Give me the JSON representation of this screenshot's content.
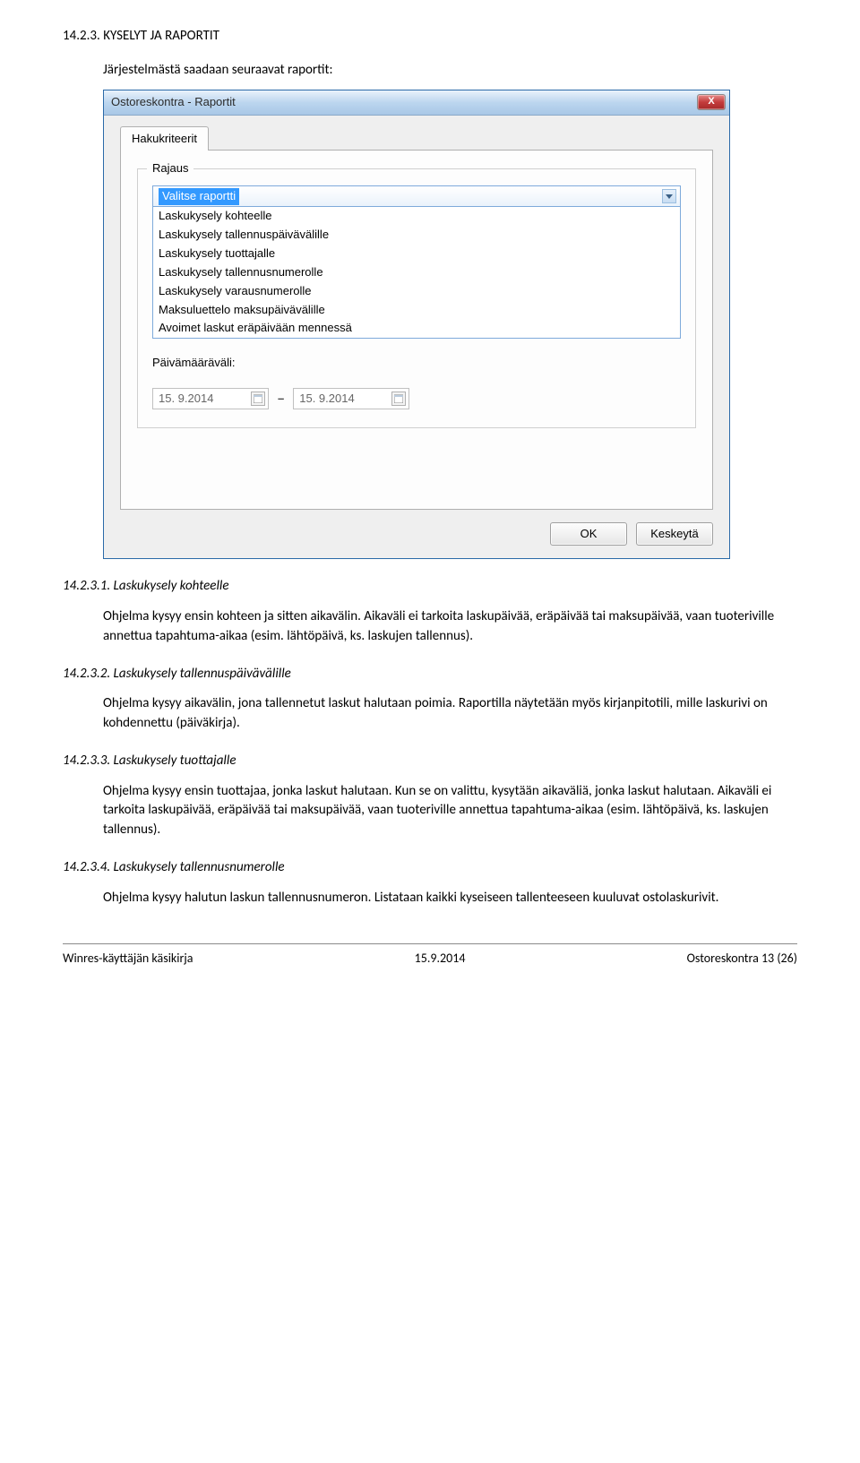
{
  "section": {
    "number": "14.2.3.",
    "title": "KYSELYT JA RAPORTIT",
    "intro": "Järjestelmästä saadaan seuraavat raportit:"
  },
  "dialog": {
    "title": "Ostoreskontra - Raportit",
    "close_label": "X",
    "tab_label": "Hakukriteerit",
    "legend": "Rajaus",
    "selected": "Valitse raportti",
    "options": [
      "Laskukysely kohteelle",
      "Laskukysely tallennuspäivävälille",
      "Laskukysely tuottajalle",
      "Laskukysely tallennusnumerolle",
      "Laskukysely varausnumerolle",
      "Maksuluettelo maksupäivävälille",
      "Avoimet laskut eräpäivään mennessä"
    ],
    "date_label": "Päivämääräväli:",
    "date_from": "15. 9.2014",
    "date_to": "15. 9.2014",
    "date_sep": "–",
    "ok_label": "OK",
    "cancel_label": "Keskeytä"
  },
  "subsections": {
    "s1": {
      "heading": "14.2.3.1. Laskukysely kohteelle",
      "body": "Ohjelma kysyy ensin kohteen ja sitten aikavälin. Aikaväli ei tarkoita laskupäivää, eräpäivää tai maksupäivää, vaan tuoteriville annettua tapahtuma-aikaa (esim. lähtöpäivä, ks. laskujen tallennus)."
    },
    "s2": {
      "heading": "14.2.3.2. Laskukysely tallennuspäivävälille",
      "body": "Ohjelma kysyy aikavälin, jona tallennetut laskut halutaan poimia. Raportilla näytetään myös kirjanpitotili, mille laskurivi on kohdennettu (päiväkirja)."
    },
    "s3": {
      "heading": "14.2.3.3. Laskukysely tuottajalle",
      "body": "Ohjelma kysyy ensin tuottajaa, jonka laskut halutaan. Kun se on valittu, kysytään aikaväliä, jonka laskut halutaan. Aikaväli ei tarkoita laskupäivää, eräpäivää tai maksupäivää, vaan tuoteriville annettua tapahtuma-aikaa (esim. lähtöpäivä, ks. laskujen tallennus)."
    },
    "s4": {
      "heading": "14.2.3.4. Laskukysely tallennusnumerolle",
      "body": "Ohjelma kysyy halutun laskun tallennusnumeron. Listataan kaikki kyseiseen tallenteeseen kuuluvat ostolaskurivit."
    }
  },
  "footer": {
    "left": "Winres-käyttäjän käsikirja",
    "center": "15.9.2014",
    "right": "Ostoreskontra 13 (26)"
  }
}
